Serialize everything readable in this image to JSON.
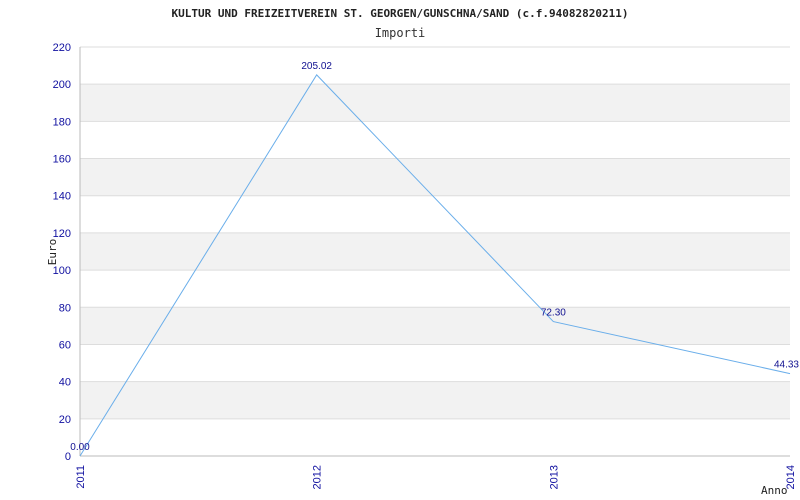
{
  "chart_data": {
    "type": "line",
    "title": "KULTUR UND FREIZEITVEREIN ST. GEORGEN/GUNSCHNA/SAND (c.f.94082820211)",
    "subtitle": "Importi",
    "xlabel": "Anno",
    "ylabel": "Euro",
    "categories": [
      "2011",
      "2012",
      "2013",
      "2014"
    ],
    "series": [
      {
        "values": [
          0.0,
          205.02,
          72.3,
          44.33
        ],
        "labels": [
          "0.00",
          "205.02",
          "72.30",
          "44.33"
        ]
      }
    ],
    "ylim": [
      0,
      220
    ],
    "yticks": [
      0,
      20,
      40,
      60,
      80,
      100,
      120,
      140,
      160,
      180,
      200,
      220
    ],
    "grid": "horizontal alternating bands",
    "colors": {
      "line": "#6aaeea",
      "band": "#f2f2f2",
      "grid": "#dddddd",
      "tick_text": "#1010a0"
    }
  }
}
